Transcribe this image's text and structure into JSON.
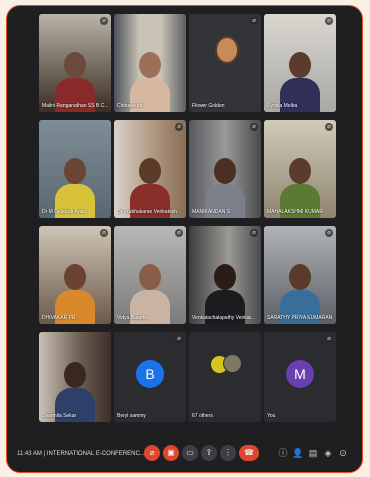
{
  "participants": [
    {
      "name": "Malini Ranganathan SS B.C...",
      "muted": true
    },
    {
      "name": "Chitralekha",
      "muted": false
    },
    {
      "name": "Flower Golden",
      "muted": true
    },
    {
      "name": "Syndia Melba",
      "muted": true
    },
    {
      "name": "Dr M Deborah Anbu",
      "muted": false
    },
    {
      "name": "Dr Prabhakaran Venkatesh",
      "muted": true
    },
    {
      "name": "MANIKANDAN S",
      "muted": true
    },
    {
      "name": "MAHALAKSHMI KUMAR",
      "muted": true
    },
    {
      "name": "DHIVAKAR PR",
      "muted": true
    },
    {
      "name": "Vidya Barathi",
      "muted": true
    },
    {
      "name": "Venkatachalapathy Venkat...",
      "muted": true
    },
    {
      "name": "SARATHY PRIYA KUMARAN",
      "muted": true
    },
    {
      "name": "Sharmila Sekar",
      "muted": false
    },
    {
      "name": "Beryl sammy",
      "muted": true,
      "avatar_letter": "B"
    },
    {
      "name": "67 others",
      "muted": false
    },
    {
      "name": "You",
      "muted": true,
      "avatar_letter": "M"
    }
  ],
  "meeting": {
    "time": "11:43 AM",
    "separator": "|",
    "title": "INTERNATIONAL E-CONFERENC..."
  },
  "controls": {
    "mic": "mic-off-icon",
    "camera": "camera-off-icon",
    "captions": "captions-icon",
    "present": "present-screen-icon",
    "more": "more-options-icon",
    "hangup": "end-call-icon",
    "info": "info-icon",
    "people": "people-icon",
    "chat": "chat-icon",
    "activities": "activities-icon",
    "lock": "host-controls-icon"
  },
  "colors": {
    "frame_border": "#d9532a",
    "background": "#1f1f21",
    "avatar_b": "#1a73e8",
    "avatar_m": "#6a3fb0",
    "end_call": "#e0452d"
  }
}
